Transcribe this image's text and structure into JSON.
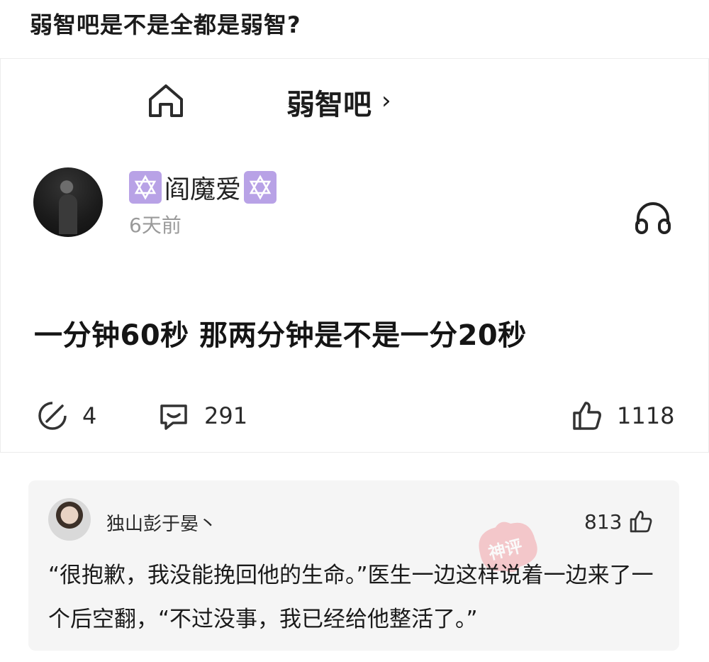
{
  "page": {
    "title": "弱智吧是不是全都是弱智?"
  },
  "post": {
    "forum_name": "弱智吧",
    "chevron": "›",
    "author": {
      "name": "阎魔爱",
      "badge_icon": "star-of-david-icon"
    },
    "time": "6天前",
    "content": "一分钟60秒 那两分钟是不是一分20秒",
    "stats": {
      "shares": "4",
      "comments": "291",
      "likes": "1118"
    }
  },
  "top_comment": {
    "user": "独山彭于晏丶",
    "likes": "813",
    "stamp_label": "神评",
    "text": "“很抱歉，我没能挽回他的生命。”医生一边这样说着一边来了一个后空翻，“不过没事，我已经给他整活了。”"
  },
  "colors": {
    "badge": "#b8a2e6",
    "stamp": "#f2a2a8",
    "comment_bg": "#f5f5f5",
    "muted": "#9a9a9a"
  }
}
